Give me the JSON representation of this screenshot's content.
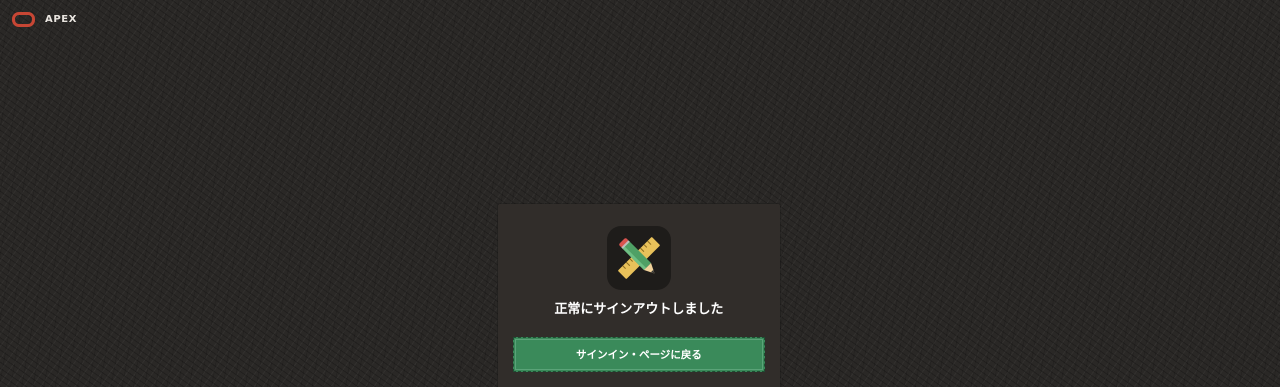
{
  "header": {
    "logo_icon": "oracle-logo-icon",
    "app_name": "APEX"
  },
  "signout_card": {
    "icon": "pencil-ruler-icon",
    "message": "正常にサインアウトしました",
    "button_label": "サインイン・ページに戻る"
  },
  "colors": {
    "accent_logo": "#c74634",
    "button_bg": "#3a8a5a",
    "card_bg": "#312d2a",
    "page_bg": "#2a2826"
  }
}
